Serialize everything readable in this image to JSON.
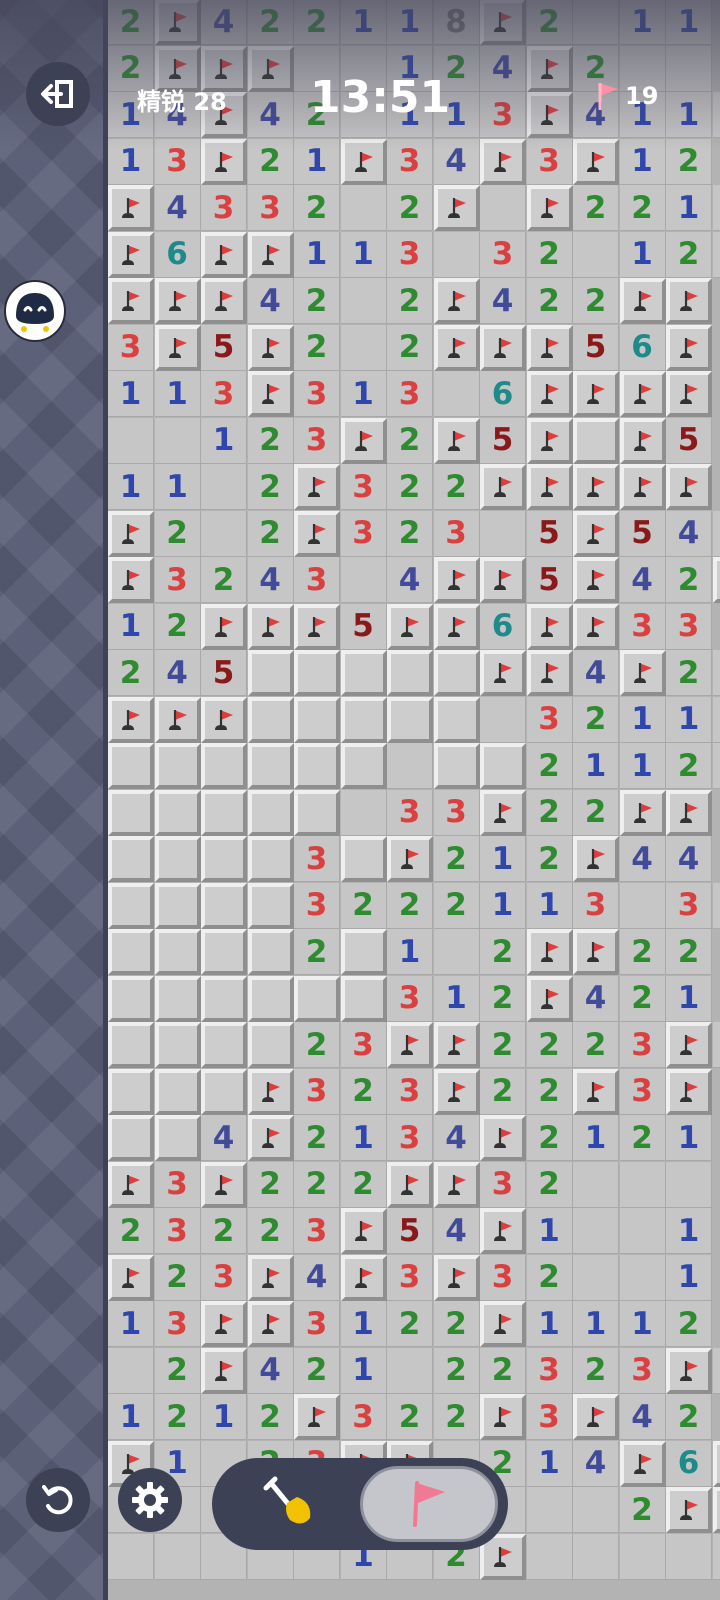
{
  "header": {
    "difficulty_label": "精锐 28",
    "timer": "13:51",
    "flags_remaining": "19"
  },
  "icons": {
    "exit": "exit-door-icon",
    "flag": "flag-icon",
    "restart": "restart-icon",
    "settings": "gear-icon",
    "dig": "shovel-icon",
    "avatar": "avatar-icon"
  },
  "colors": {
    "n1": "#2f46ad",
    "n2": "#2e8b2f",
    "n3": "#d9403f",
    "n4": "#424a9a",
    "n5": "#8a1a1a",
    "n6": "#1f8a8a",
    "flag": "#e03c3c",
    "accent_yellow": "#f2c200",
    "tool_active": "#c5c6cc"
  },
  "toolbar": {
    "mode": "flag"
  },
  "board": {
    "legend": "F = flagged cell, # = covered cell, . = opened empty cell, digit = adjacent mine count",
    "rows": [
      "2F422118F2.11",
      "2FFF..124F2..",
      "14F42.113F4111",
      "13F21F34F3F12",
      "F4332.2F.F2211",
      "F6FF113.32.124",
      "FFF42.2F422FF",
      "3F5F2.2FFF56F",
      "113F313.6FFFF",
      "..123F2F5F#F5",
      "11.2F322FFFFF",
      "F2.2F323.5F543",
      "F3243.4FF5F42F",
      "12FFF5FF6FF33",
      "245#####FF4F22",
      "FFF#####.32112",
      "######.##2112.3",
      "#####.33F22FF",
      "####3#F212F44",
      "####3222113.33F",
      "####2#1.2FF22",
      "######312F421",
      "####23FF2223F2",
      "###F323F22F3F",
      "##4F2134F2121",
      "F3F222FF32...",
      "23223F54F1..1",
      "F23F4F3F32..1",
      "13FF3122F1112",
      ".2F421.22323F1",
      "1212F322F3F42",
      "F1.23FF.214F6F",
      "...........2FFF",
      ".....1.2F....1.24F"
    ]
  }
}
